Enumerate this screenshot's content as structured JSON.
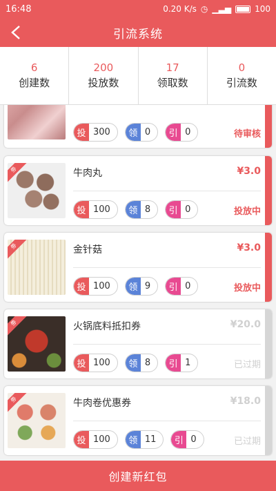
{
  "status_bar": {
    "time": "16:48",
    "speed": "0.20 K/s",
    "battery": "100"
  },
  "header": {
    "title": "引流系统"
  },
  "stats": [
    {
      "value": "6",
      "label": "创建数"
    },
    {
      "value": "200",
      "label": "投放数"
    },
    {
      "value": "17",
      "label": "领取数"
    },
    {
      "value": "0",
      "label": "引流数"
    }
  ],
  "metric_tags": {
    "tou": "投",
    "ling": "领",
    "yin": "引"
  },
  "ribbon_text": "劵",
  "cards": [
    {
      "name": "",
      "price": "",
      "tou": "300",
      "ling": "0",
      "yin": "0",
      "status": "待审核",
      "expired": false
    },
    {
      "name": "牛肉丸",
      "price": "¥3.0",
      "tou": "100",
      "ling": "8",
      "yin": "0",
      "status": "投放中",
      "expired": false
    },
    {
      "name": "金针菇",
      "price": "¥3.0",
      "tou": "100",
      "ling": "9",
      "yin": "0",
      "status": "投放中",
      "expired": false
    },
    {
      "name": "火锅底料抵扣券",
      "price": "¥20.0",
      "tou": "100",
      "ling": "8",
      "yin": "1",
      "status": "已过期",
      "expired": true
    },
    {
      "name": "牛肉卷优惠券",
      "price": "¥18.0",
      "tou": "100",
      "ling": "11",
      "yin": "0",
      "status": "已过期",
      "expired": true
    }
  ],
  "colors": {
    "primary": "#e95a5c",
    "tou": "#e95a5c",
    "ling": "#5b83d8",
    "yin": "#e84a91",
    "expired": "#d0d0d0"
  },
  "footer": {
    "create_label": "创建新红包"
  }
}
